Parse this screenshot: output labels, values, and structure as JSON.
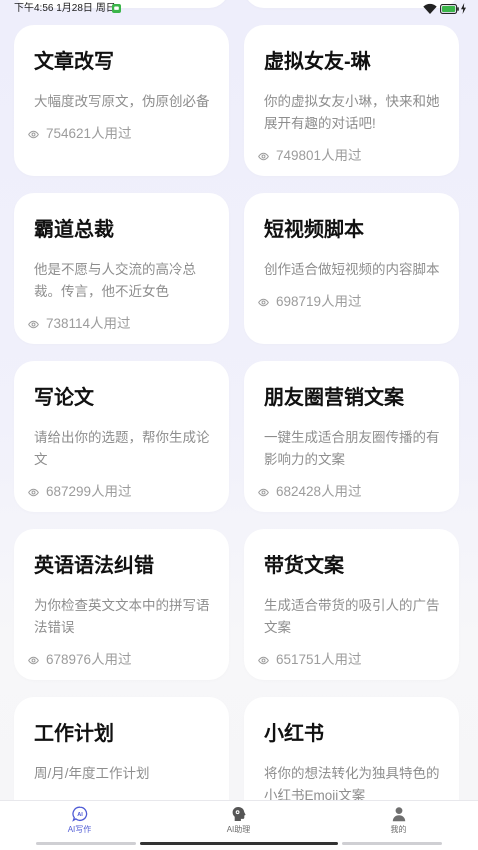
{
  "status_bar": {
    "datetime": "下午4:56 1月28日 周日",
    "notification_icon": "app-notification-icon",
    "wifi_icon": "wifi-icon",
    "battery_icon": "battery-icon",
    "charging_icon": "charging-bolt-icon",
    "notification_color": "#3bb54a",
    "battery_color": "#3bb54a"
  },
  "common": {
    "uses_suffix": "人用过",
    "uses_icon": "eye-icon"
  },
  "cards": [
    {
      "title": "文章改写",
      "desc": "大幅度改写原文，伪原创必备",
      "count": "754621"
    },
    {
      "title": "虚拟女友-琳",
      "desc": "你的虚拟女友小琳，快来和她展开有趣的对话吧!",
      "count": "749801"
    },
    {
      "title": "霸道总裁",
      "desc": "他是不愿与人交流的高冷总裁。传言，他不近女色",
      "count": "738114"
    },
    {
      "title": "短视频脚本",
      "desc": "创作适合做短视频的内容脚本",
      "count": "698719"
    },
    {
      "title": "写论文",
      "desc": "请给出你的选题，帮你生成论文",
      "count": "687299"
    },
    {
      "title": "朋友圈营销文案",
      "desc": "一键生成适合朋友圈传播的有影响力的文案",
      "count": "682428"
    },
    {
      "title": "英语语法纠错",
      "desc": "为你检查英文文本中的拼写语法错误",
      "count": "678976"
    },
    {
      "title": "带货文案",
      "desc": "生成适合带货的吸引人的广告文案",
      "count": "651751"
    },
    {
      "title": "工作计划",
      "desc": "周/月/年度工作计划"
    },
    {
      "title": "小红书",
      "desc": "将你的想法转化为独具特色的小红书Emoji文案"
    }
  ],
  "bottom_nav": {
    "items": [
      {
        "label": "AI写作",
        "icon": "ai-writing-icon",
        "icon_text": "AI",
        "active": true
      },
      {
        "label": "AI助理",
        "icon": "ai-assistant-head-icon",
        "active": false
      },
      {
        "label": "我的",
        "icon": "user-profile-icon",
        "active": false
      }
    ],
    "active_color": "#4f5bd5",
    "inactive_color": "#6b6b6b"
  }
}
